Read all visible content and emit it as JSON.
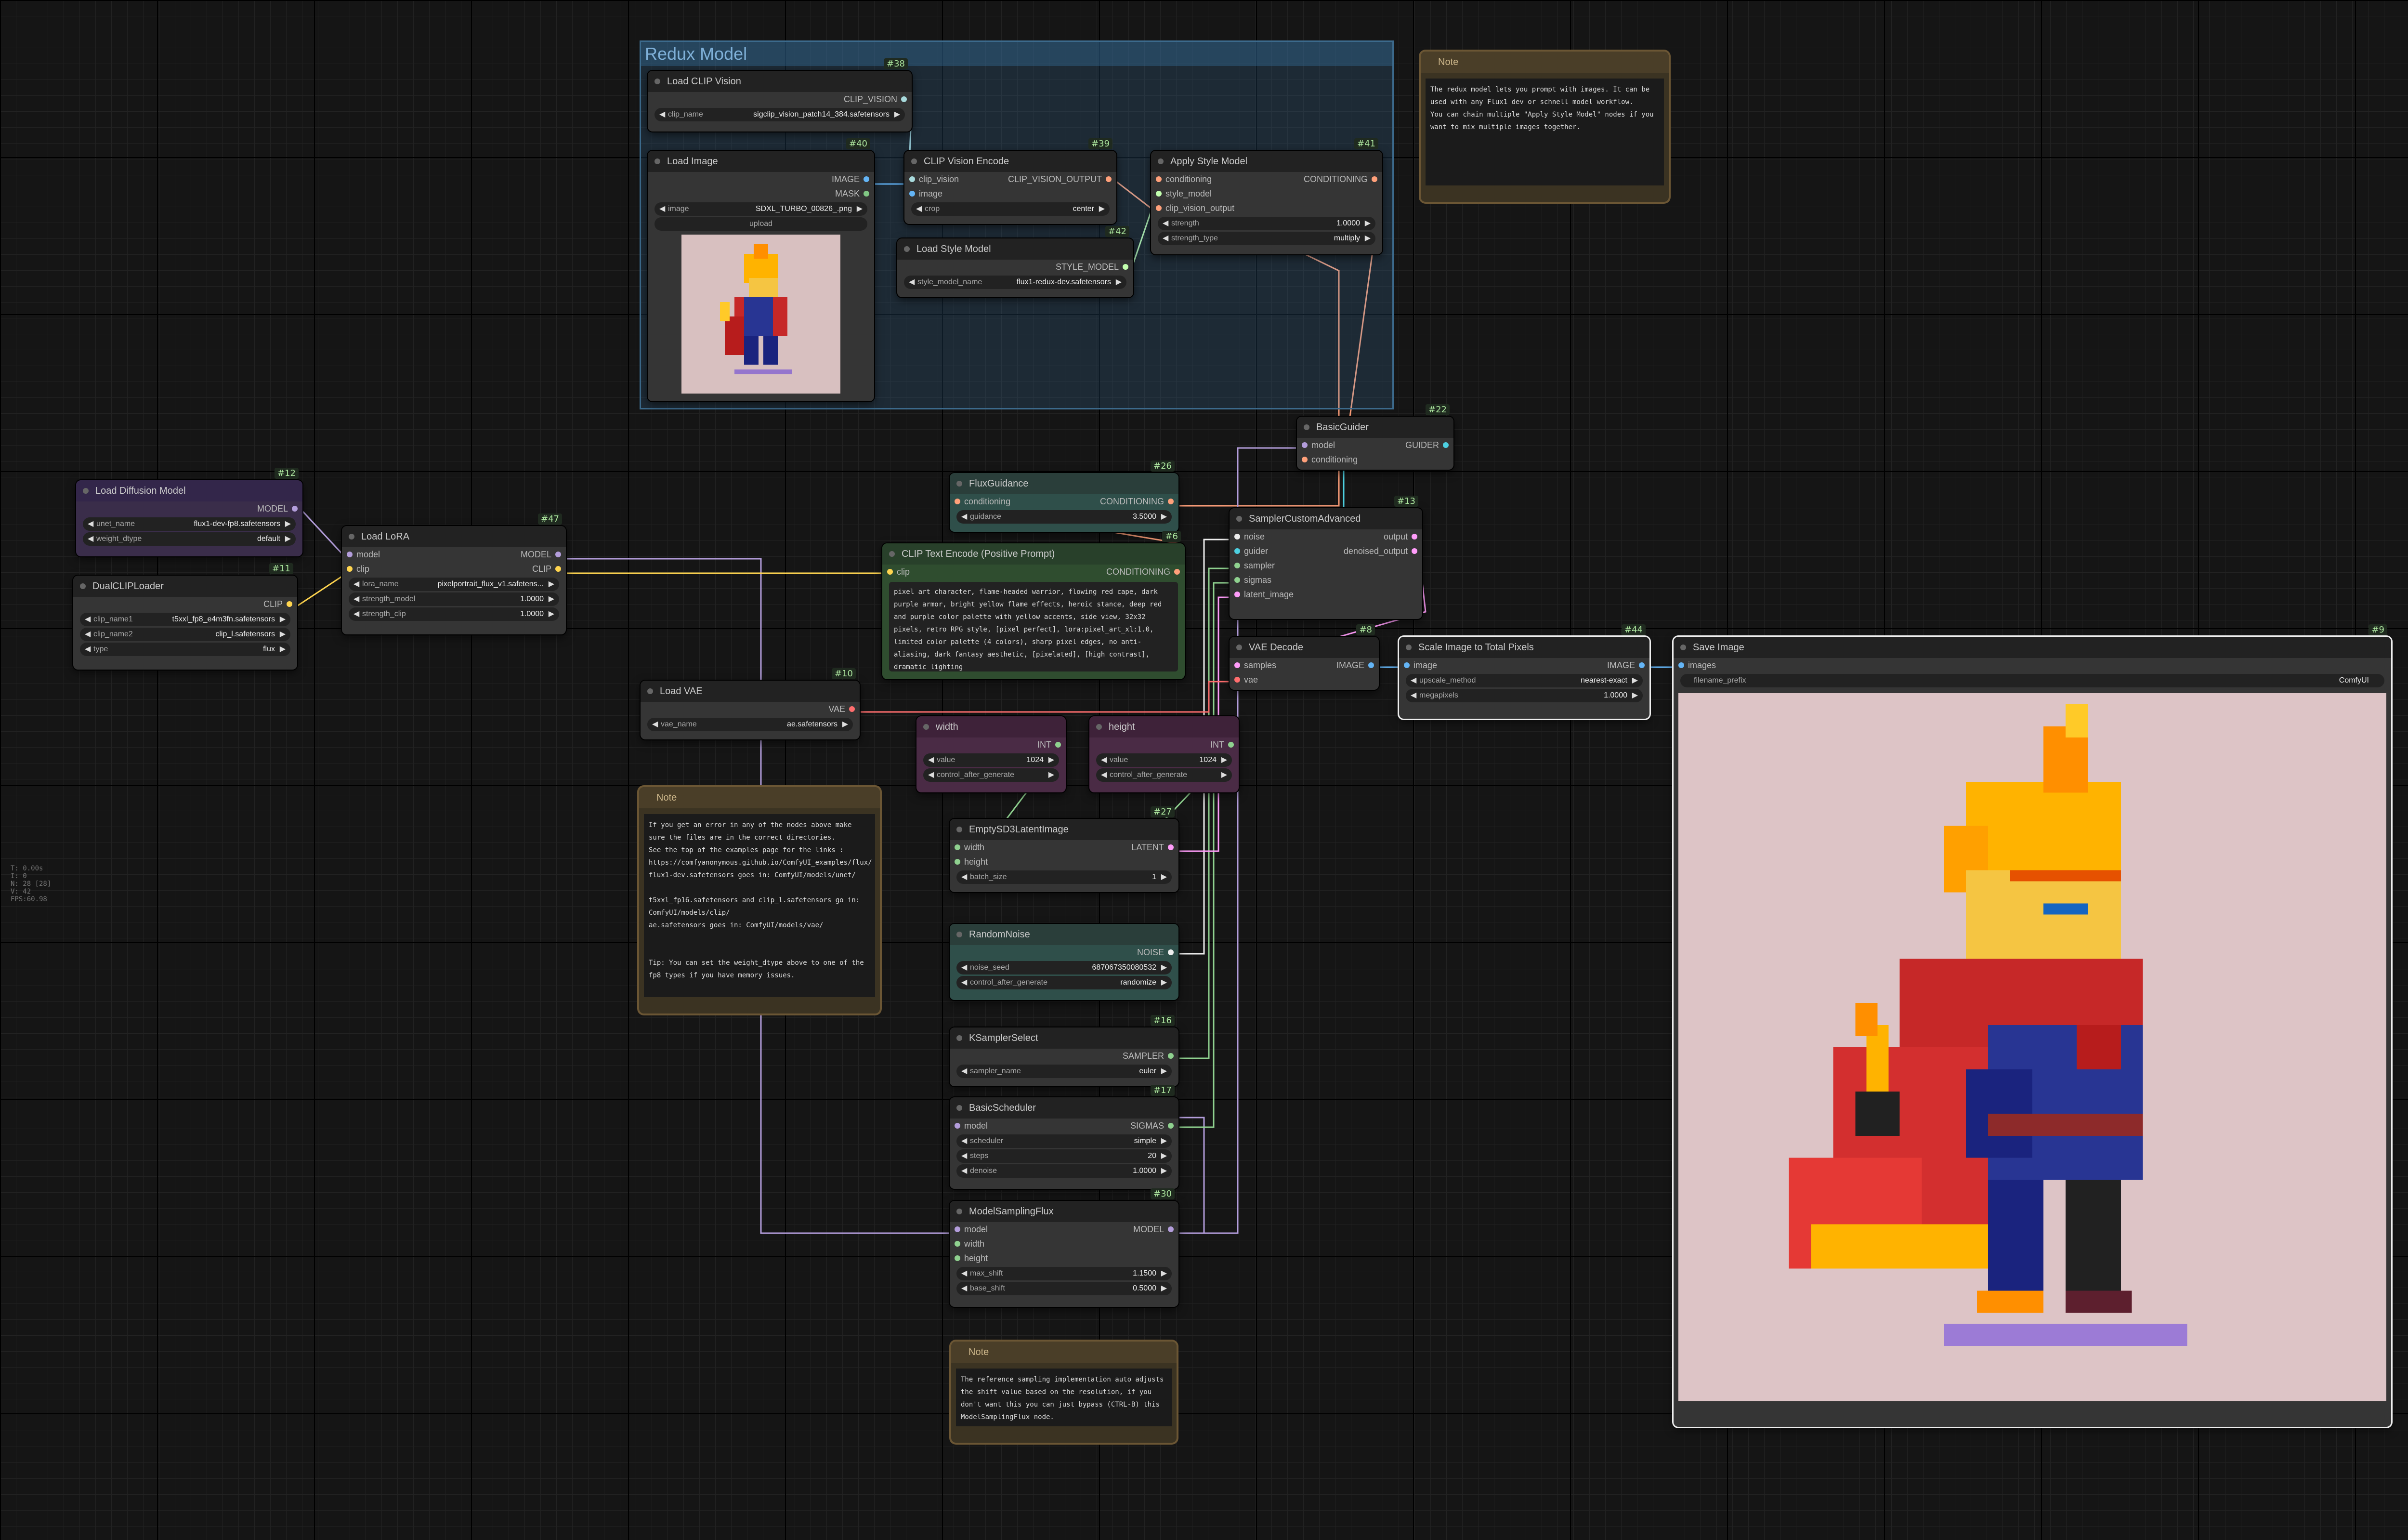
{
  "group": {
    "title": "Redux Model"
  },
  "stats": [
    "T: 0.00s",
    "I: 0",
    "N: 28 [28]",
    "V: 42",
    "FPS:60.98"
  ],
  "nodes": {
    "load_clip_vision": {
      "id": "#38",
      "title": "Load CLIP Vision",
      "out": "CLIP_VISION",
      "w_name": "clip_name",
      "w_value": "sigclip_vision_patch14_384.safetensors"
    },
    "load_image": {
      "id": "#40",
      "title": "Load Image",
      "out1": "IMAGE",
      "out2": "MASK",
      "w_name": "image",
      "w_value": "SDXL_TURBO_00826_.png",
      "upload": "upload"
    },
    "clip_vision_encode": {
      "id": "#39",
      "title": "CLIP Vision Encode",
      "in1": "clip_vision",
      "in2": "image",
      "out": "CLIP_VISION_OUTPUT",
      "w_name": "crop",
      "w_value": "center"
    },
    "apply_style": {
      "id": "#41",
      "title": "Apply Style Model",
      "in1": "conditioning",
      "in2": "style_model",
      "in3": "clip_vision_output",
      "out": "CONDITIONING",
      "w1_name": "strength",
      "w1_value": "1.0000",
      "w2_name": "strength_type",
      "w2_value": "multiply"
    },
    "load_style": {
      "id": "#42",
      "title": "Load Style Model",
      "out": "STYLE_MODEL",
      "w_name": "style_model_name",
      "w_value": "flux1-redux-dev.safetensors"
    },
    "load_diffusion": {
      "id": "#12",
      "title": "Load Diffusion Model",
      "out": "MODEL",
      "w1_name": "unet_name",
      "w1_value": "flux1-dev-fp8.safetensors",
      "w2_name": "weight_dtype",
      "w2_value": "default"
    },
    "dual_clip": {
      "id": "#11",
      "title": "DualCLIPLoader",
      "out": "CLIP",
      "w1_name": "clip_name1",
      "w1_value": "t5xxl_fp8_e4m3fn.safetensors",
      "w2_name": "clip_name2",
      "w2_value": "clip_l.safetensors",
      "w3_name": "type",
      "w3_value": "flux"
    },
    "load_lora": {
      "id": "#47",
      "title": "Load LoRA",
      "in1": "model",
      "in2": "clip",
      "out1": "MODEL",
      "out2": "CLIP",
      "w1_name": "lora_name",
      "w1_value": "pixelportrait_flux_v1.safetens...",
      "w2_name": "strength_model",
      "w2_value": "1.0000",
      "w3_name": "strength_clip",
      "w3_value": "1.0000"
    },
    "flux_guidance": {
      "id": "#26",
      "title": "FluxGuidance",
      "in": "conditioning",
      "out": "CONDITIONING",
      "w_name": "guidance",
      "w_value": "3.5000"
    },
    "clip_text": {
      "id": "#6",
      "title": "CLIP Text Encode (Positive Prompt)",
      "in": "clip",
      "out": "CONDITIONING",
      "text": "pixel art character, flame-headed warrior, flowing red cape, dark purple armor, bright yellow flame effects, heroic stance, deep red and purple color palette with yellow accents, side view, 32x32 pixels, retro RPG style, [pixel perfect], lora:pixel_art_xl:1.0, limited color palette (4 colors), sharp pixel edges, no anti-aliasing, dark fantasy aesthetic, [pixelated], [high contrast], dramatic lighting"
    },
    "load_vae": {
      "id": "#10",
      "title": "Load VAE",
      "out": "VAE",
      "w_name": "vae_name",
      "w_value": "ae.safetensors"
    },
    "width": {
      "title": "width",
      "out": "INT",
      "w1_name": "value",
      "w1_value": "1024",
      "w2_name": "control_after_generate",
      "w2_value": ""
    },
    "height": {
      "title": "height",
      "out": "INT",
      "w1_name": "value",
      "w1_value": "1024",
      "w2_name": "control_after_generate",
      "w2_value": ""
    },
    "basic_guider": {
      "id": "#22",
      "title": "BasicGuider",
      "in1": "model",
      "in2": "conditioning",
      "out": "GUIDER"
    },
    "sampler_adv": {
      "id": "#13",
      "title": "SamplerCustomAdvanced",
      "in1": "noise",
      "in2": "guider",
      "in3": "sampler",
      "in4": "sigmas",
      "in5": "latent_image",
      "out1": "output",
      "out2": "denoised_output"
    },
    "vae_decode": {
      "id": "#8",
      "title": "VAE Decode",
      "in1": "samples",
      "in2": "vae",
      "out": "IMAGE"
    },
    "scale_image": {
      "id": "#44",
      "title": "Scale Image to Total Pixels",
      "in": "image",
      "out": "IMAGE",
      "w1_name": "upscale_method",
      "w1_value": "nearest-exact",
      "w2_name": "megapixels",
      "w2_value": "1.0000"
    },
    "save_image": {
      "id": "#9",
      "title": "Save Image",
      "in": "images",
      "w_name": "filename_prefix",
      "w_value": "ComfyUI"
    },
    "empty_latent": {
      "id": "#27",
      "title": "EmptySD3LatentImage",
      "in1": "width",
      "in2": "height",
      "out": "LATENT",
      "w_name": "batch_size",
      "w_value": "1"
    },
    "random_noise": {
      "id": "#25",
      "title": "RandomNoise",
      "out": "NOISE",
      "w1_name": "noise_seed",
      "w1_value": "687067350080532",
      "w2_name": "control_after_generate",
      "w2_value": "randomize"
    },
    "ksampler_select": {
      "id": "#16",
      "title": "KSamplerSelect",
      "out": "SAMPLER",
      "w_name": "sampler_name",
      "w_value": "euler"
    },
    "basic_scheduler": {
      "id": "#17",
      "title": "BasicScheduler",
      "in": "model",
      "out": "SIGMAS",
      "w1_name": "scheduler",
      "w1_value": "simple",
      "w2_name": "steps",
      "w2_value": "20",
      "w3_name": "denoise",
      "w3_value": "1.0000"
    },
    "model_sampling": {
      "id": "#30",
      "title": "ModelSamplingFlux",
      "in1": "model",
      "in2": "width",
      "in3": "height",
      "out": "MODEL",
      "w1_name": "max_shift",
      "w1_value": "1.1500",
      "w2_name": "base_shift",
      "w2_value": "0.5000"
    }
  },
  "notes": {
    "redux": {
      "title": "Note",
      "text": "The redux model lets you prompt with images. It can be used with any Flux1 dev or schnell model workflow.\nYou can chain multiple \"Apply Style Model\" nodes if you want to mix multiple images together."
    },
    "errors": {
      "title": "Note",
      "text": "If you get an error in any of the nodes above make sure the files are in the correct directories.\nSee the top of the examples page for the links : https://comfyanonymous.github.io/ComfyUI_examples/flux/\nflux1-dev.safetensors goes in: ComfyUI/models/unet/\n\nt5xxl_fp16.safetensors and clip_l.safetensors go in: ComfyUI/models/clip/\nae.safetensors goes in: ComfyUI/models/vae/\n\n\nTip: You can set the weight_dtype above to one of the fp8 types if you have memory issues."
    },
    "sampling": {
      "title": "Note",
      "text": "The reference sampling implementation auto adjusts the shift value based on the resolution, if you don't want this you can just bypass (CTRL-B) this ModelSamplingFlux node."
    }
  },
  "colors": {
    "model": "#b39ddb",
    "clip": "#ffd54f",
    "conditioning": "#ffa07a",
    "image": "#64b5f6",
    "vae": "#ff6e6e",
    "latent": "#ff9cf9",
    "int": "#8fd18f",
    "clip_vision": "#a8dadc",
    "style": "#c2ffae"
  },
  "icons": [
    "triangle-left-icon",
    "triangle-right-icon",
    "node-dot-icon"
  ]
}
